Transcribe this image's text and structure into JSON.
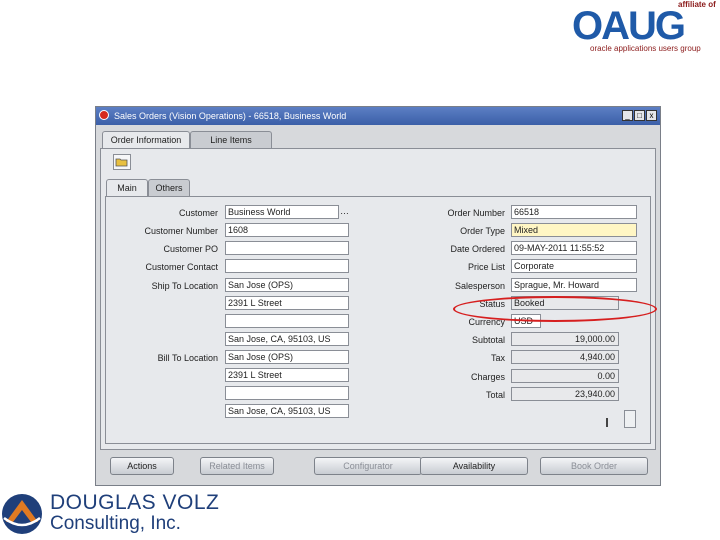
{
  "logo_oaug": {
    "affiliate": "affiliate of",
    "wordmark": "OAUG",
    "subtitle": "oracle applications users group"
  },
  "window": {
    "title": "Sales Orders (Vision Operations) - 66518, Business World",
    "min": "_",
    "max": "□",
    "close": "x"
  },
  "top_tabs": [
    "Order Information",
    "Line Items"
  ],
  "sub_tabs": [
    "Main",
    "Others"
  ],
  "left": {
    "customer": {
      "label": "Customer",
      "value": "Business World"
    },
    "customer_number": {
      "label": "Customer Number",
      "value": "1608"
    },
    "customer_po": {
      "label": "Customer PO",
      "value": ""
    },
    "customer_contact": {
      "label": "Customer Contact",
      "value": ""
    },
    "ship_to": {
      "label": "Ship To Location",
      "lines": [
        "San Jose (OPS)",
        "2391 L Street",
        "",
        "San Jose, CA, 95103, US"
      ]
    },
    "bill_to": {
      "label": "Bill To Location",
      "lines": [
        "San Jose (OPS)",
        "2391 L Street",
        "",
        "San Jose, CA, 95103, US"
      ]
    }
  },
  "right": {
    "order_number": {
      "label": "Order Number",
      "value": "66518"
    },
    "order_type": {
      "label": "Order Type",
      "value": "Mixed"
    },
    "date_ordered": {
      "label": "Date Ordered",
      "value": "09-MAY-2011 11:55:52"
    },
    "price_list": {
      "label": "Price List",
      "value": "Corporate"
    },
    "salesperson": {
      "label": "Salesperson",
      "value": "Sprague, Mr. Howard"
    },
    "status": {
      "label": "Status",
      "value": "Booked"
    },
    "currency": {
      "label": "Currency",
      "value": "USD"
    },
    "subtotal": {
      "label": "Subtotal",
      "value": "19,000.00"
    },
    "tax": {
      "label": "Tax",
      "value": "4,940.00"
    },
    "charges": {
      "label": "Charges",
      "value": "0.00"
    },
    "total": {
      "label": "Total",
      "value": "23,940.00"
    }
  },
  "buttons": [
    "Actions",
    "Related Items",
    "Configurator",
    "Availability",
    "Book Order"
  ],
  "logo_dv": {
    "line1": "DOUGLAS VOLZ",
    "line2": "Consulting, Inc."
  },
  "colors": {
    "status_highlight": "#d61f1f",
    "title_bar": "#3b5fa8",
    "required_field": "#fff6c4"
  }
}
